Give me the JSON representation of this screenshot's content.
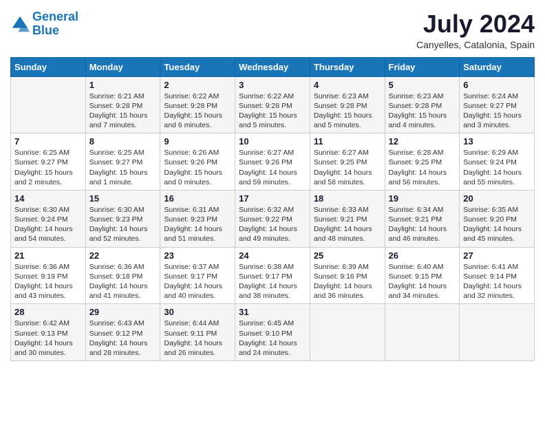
{
  "logo": {
    "line1": "General",
    "line2": "Blue"
  },
  "title": "July 2024",
  "location": "Canyelles, Catalonia, Spain",
  "days_of_week": [
    "Sunday",
    "Monday",
    "Tuesday",
    "Wednesday",
    "Thursday",
    "Friday",
    "Saturday"
  ],
  "weeks": [
    [
      {
        "day": "",
        "info": ""
      },
      {
        "day": "1",
        "info": "Sunrise: 6:21 AM\nSunset: 9:28 PM\nDaylight: 15 hours\nand 7 minutes."
      },
      {
        "day": "2",
        "info": "Sunrise: 6:22 AM\nSunset: 9:28 PM\nDaylight: 15 hours\nand 6 minutes."
      },
      {
        "day": "3",
        "info": "Sunrise: 6:22 AM\nSunset: 9:28 PM\nDaylight: 15 hours\nand 5 minutes."
      },
      {
        "day": "4",
        "info": "Sunrise: 6:23 AM\nSunset: 9:28 PM\nDaylight: 15 hours\nand 5 minutes."
      },
      {
        "day": "5",
        "info": "Sunrise: 6:23 AM\nSunset: 9:28 PM\nDaylight: 15 hours\nand 4 minutes."
      },
      {
        "day": "6",
        "info": "Sunrise: 6:24 AM\nSunset: 9:27 PM\nDaylight: 15 hours\nand 3 minutes."
      }
    ],
    [
      {
        "day": "7",
        "info": "Sunrise: 6:25 AM\nSunset: 9:27 PM\nDaylight: 15 hours\nand 2 minutes."
      },
      {
        "day": "8",
        "info": "Sunrise: 6:25 AM\nSunset: 9:27 PM\nDaylight: 15 hours\nand 1 minute."
      },
      {
        "day": "9",
        "info": "Sunrise: 6:26 AM\nSunset: 9:26 PM\nDaylight: 15 hours\nand 0 minutes."
      },
      {
        "day": "10",
        "info": "Sunrise: 6:27 AM\nSunset: 9:26 PM\nDaylight: 14 hours\nand 59 minutes."
      },
      {
        "day": "11",
        "info": "Sunrise: 6:27 AM\nSunset: 9:25 PM\nDaylight: 14 hours\nand 58 minutes."
      },
      {
        "day": "12",
        "info": "Sunrise: 6:28 AM\nSunset: 9:25 PM\nDaylight: 14 hours\nand 56 minutes."
      },
      {
        "day": "13",
        "info": "Sunrise: 6:29 AM\nSunset: 9:24 PM\nDaylight: 14 hours\nand 55 minutes."
      }
    ],
    [
      {
        "day": "14",
        "info": "Sunrise: 6:30 AM\nSunset: 9:24 PM\nDaylight: 14 hours\nand 54 minutes."
      },
      {
        "day": "15",
        "info": "Sunrise: 6:30 AM\nSunset: 9:23 PM\nDaylight: 14 hours\nand 52 minutes."
      },
      {
        "day": "16",
        "info": "Sunrise: 6:31 AM\nSunset: 9:23 PM\nDaylight: 14 hours\nand 51 minutes."
      },
      {
        "day": "17",
        "info": "Sunrise: 6:32 AM\nSunset: 9:22 PM\nDaylight: 14 hours\nand 49 minutes."
      },
      {
        "day": "18",
        "info": "Sunrise: 6:33 AM\nSunset: 9:21 PM\nDaylight: 14 hours\nand 48 minutes."
      },
      {
        "day": "19",
        "info": "Sunrise: 6:34 AM\nSunset: 9:21 PM\nDaylight: 14 hours\nand 46 minutes."
      },
      {
        "day": "20",
        "info": "Sunrise: 6:35 AM\nSunset: 9:20 PM\nDaylight: 14 hours\nand 45 minutes."
      }
    ],
    [
      {
        "day": "21",
        "info": "Sunrise: 6:36 AM\nSunset: 9:19 PM\nDaylight: 14 hours\nand 43 minutes."
      },
      {
        "day": "22",
        "info": "Sunrise: 6:36 AM\nSunset: 9:18 PM\nDaylight: 14 hours\nand 41 minutes."
      },
      {
        "day": "23",
        "info": "Sunrise: 6:37 AM\nSunset: 9:17 PM\nDaylight: 14 hours\nand 40 minutes."
      },
      {
        "day": "24",
        "info": "Sunrise: 6:38 AM\nSunset: 9:17 PM\nDaylight: 14 hours\nand 38 minutes."
      },
      {
        "day": "25",
        "info": "Sunrise: 6:39 AM\nSunset: 9:16 PM\nDaylight: 14 hours\nand 36 minutes."
      },
      {
        "day": "26",
        "info": "Sunrise: 6:40 AM\nSunset: 9:15 PM\nDaylight: 14 hours\nand 34 minutes."
      },
      {
        "day": "27",
        "info": "Sunrise: 6:41 AM\nSunset: 9:14 PM\nDaylight: 14 hours\nand 32 minutes."
      }
    ],
    [
      {
        "day": "28",
        "info": "Sunrise: 6:42 AM\nSunset: 9:13 PM\nDaylight: 14 hours\nand 30 minutes."
      },
      {
        "day": "29",
        "info": "Sunrise: 6:43 AM\nSunset: 9:12 PM\nDaylight: 14 hours\nand 28 minutes."
      },
      {
        "day": "30",
        "info": "Sunrise: 6:44 AM\nSunset: 9:11 PM\nDaylight: 14 hours\nand 26 minutes."
      },
      {
        "day": "31",
        "info": "Sunrise: 6:45 AM\nSunset: 9:10 PM\nDaylight: 14 hours\nand 24 minutes."
      },
      {
        "day": "",
        "info": ""
      },
      {
        "day": "",
        "info": ""
      },
      {
        "day": "",
        "info": ""
      }
    ]
  ]
}
